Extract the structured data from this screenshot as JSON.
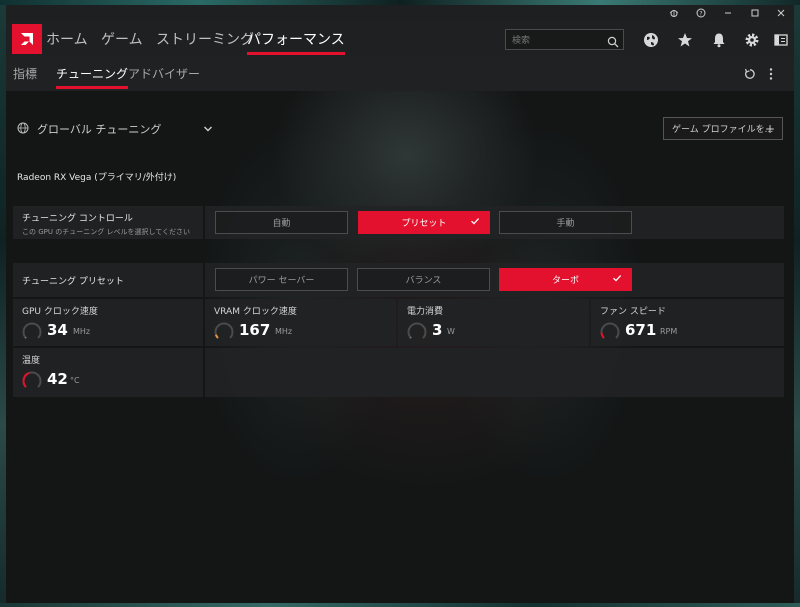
{
  "titlebar": {
    "bug_icon": "bug-icon",
    "help_icon": "help-icon",
    "minimize_icon": "minimize-icon",
    "maximize_icon": "maximize-icon",
    "close_icon": "close-icon"
  },
  "nav": {
    "logo": "amd-logo",
    "tabs": [
      {
        "label": "ホーム"
      },
      {
        "label": "ゲーム"
      },
      {
        "label": "ストリーミング"
      },
      {
        "label": "パフォーマンス"
      }
    ],
    "active_tab": "パフォーマンス",
    "search_placeholder": "検索"
  },
  "subnav": {
    "tabs": [
      {
        "label": "指標"
      },
      {
        "label": "チューニング"
      },
      {
        "label": "アドバイザー"
      }
    ],
    "active_tab": "チューニング"
  },
  "content": {
    "global_tuning_label": "グローバル チューニング",
    "profile_button": "ゲーム プロファイルを...",
    "profile_plus": "+",
    "gpu_name": "Radeon RX Vega (プライマリ/外付け)",
    "tuning_control": {
      "label": "チューニング コントロール",
      "description": "この GPU のチューニング レベルを選択してください",
      "options": [
        "自動",
        "プリセット",
        "手動"
      ],
      "selected": "プリセット"
    },
    "tuning_preset": {
      "label": "チューニング プリセット",
      "options": [
        "パワー セーバー",
        "バランス",
        "ターボ"
      ],
      "selected": "ターボ"
    },
    "metrics": [
      {
        "label": "GPU クロック速度",
        "value": "34",
        "unit": "MHz",
        "fraction": 0.02,
        "color": "#8a8a8a"
      },
      {
        "label": "VRAM クロック速度",
        "value": "167",
        "unit": "MHz",
        "fraction": 0.1,
        "color": "#e8913c"
      },
      {
        "label": "電力消費",
        "value": "3",
        "unit": "W",
        "fraction": 0.01,
        "color": "#8a8a8a"
      },
      {
        "label": "ファン スピード",
        "value": "671",
        "unit": "RPM",
        "fraction": 0.15,
        "color": "#e3112d"
      },
      {
        "label": "温度",
        "value": "42",
        "unit": "°C",
        "fraction": 0.42,
        "color": "#e3112d"
      }
    ]
  },
  "colors": {
    "accent": "#e3112d",
    "background": "#141616",
    "panel": "#222324"
  }
}
